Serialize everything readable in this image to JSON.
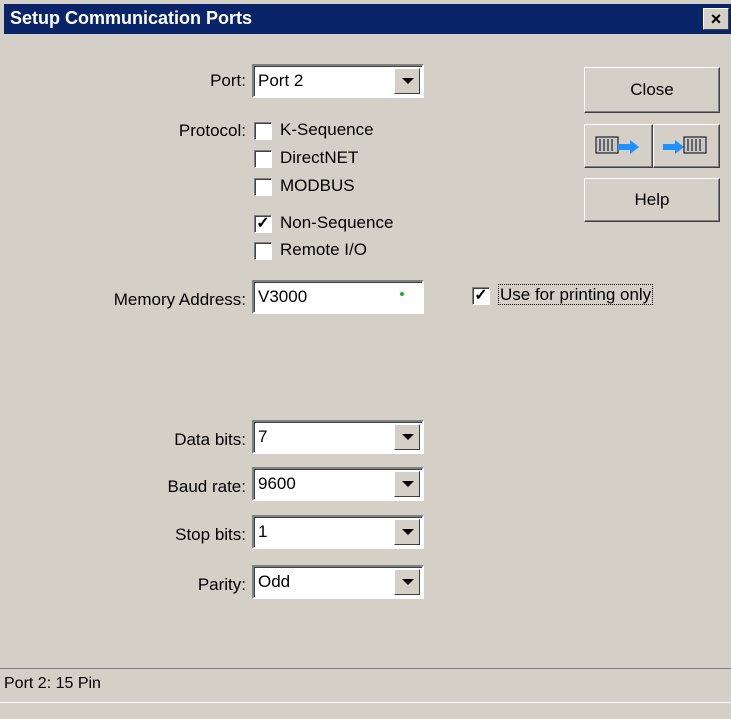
{
  "window": {
    "title": "Setup Communication Ports",
    "close_glyph": "×"
  },
  "port": {
    "label": "Port:",
    "value": "Port 2"
  },
  "protocol": {
    "label": "Protocol:",
    "options": [
      {
        "label": "K-Sequence",
        "checked": false
      },
      {
        "label": "DirectNET",
        "checked": false
      },
      {
        "label": "MODBUS",
        "checked": false
      },
      {
        "label": "Non-Sequence",
        "checked": true
      },
      {
        "label": "Remote I/O",
        "checked": false
      }
    ]
  },
  "memory_address": {
    "label": "Memory Address:",
    "value": "V3000"
  },
  "print_only": {
    "label": "Use for printing only",
    "checked": true
  },
  "data_bits": {
    "label": "Data bits:",
    "value": "7"
  },
  "baud_rate": {
    "label": "Baud rate:",
    "value": "9600"
  },
  "stop_bits": {
    "label": "Stop bits:",
    "value": "1"
  },
  "parity": {
    "label": "Parity:",
    "value": "Odd"
  },
  "buttons": {
    "close": "Close",
    "help": "Help",
    "read_icon": "plc-to-pc-icon",
    "write_icon": "pc-to-plc-icon"
  },
  "status": {
    "text": "Port 2: 15 Pin"
  },
  "colors": {
    "titlebar": "#0a246a",
    "dialog_bg": "#d4d0c8"
  }
}
